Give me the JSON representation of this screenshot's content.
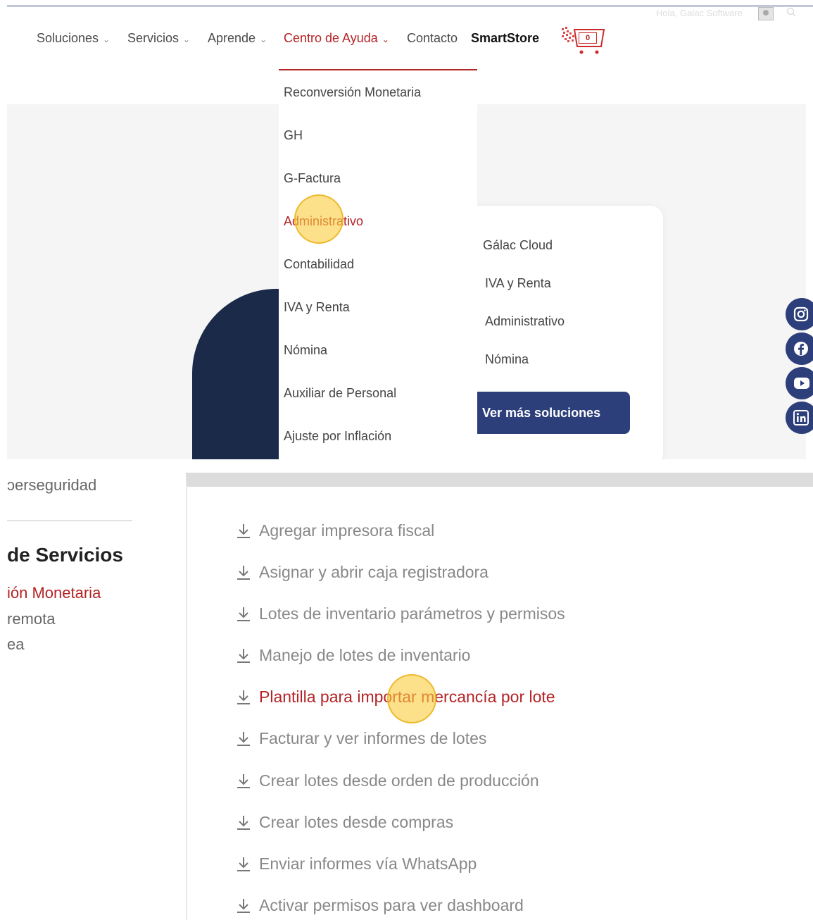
{
  "header": {
    "greeting": "Hola, Galac Software",
    "cart_count": "0"
  },
  "nav": {
    "items": [
      {
        "label": "Soluciones"
      },
      {
        "label": "Servicios"
      },
      {
        "label": "Aprende"
      },
      {
        "label": "Centro de Ayuda"
      },
      {
        "label": "Contacto"
      },
      {
        "label": "SmartStore"
      }
    ]
  },
  "dropdown": {
    "items": [
      "Reconversión Monetaria",
      "GH",
      "G-Factura",
      "Administrativo",
      "Contabilidad",
      "IVA y Renta",
      "Nómina",
      "Auxiliar de Personal",
      "Ajuste por Inflación"
    ]
  },
  "solutions": {
    "items": [
      "Gálac Cloud",
      "IVA y Renta",
      "Administrativo",
      "Nómina"
    ],
    "button": "Ver más soluciones"
  },
  "social": [
    "instagram-icon",
    "facebook-icon",
    "youtube-icon",
    "linkedin-icon"
  ],
  "sidebar": {
    "top_text": "ɔerseguridad",
    "heading": "de Servicios",
    "links": [
      "ión Monetaria",
      "remota",
      "ea"
    ]
  },
  "downloads": {
    "items": [
      "Agregar impresora fiscal",
      "Asignar y abrir caja registradora",
      "Lotes de inventario parámetros y permisos",
      "Manejo de lotes de inventario",
      "Plantilla para importar mercancía por lote",
      "Facturar y ver informes de lotes",
      "Crear lotes desde orden de producción",
      "Crear lotes desde compras",
      "Enviar informes vía WhatsApp",
      "Activar permisos para ver dashboard"
    ]
  },
  "colors": {
    "brand_red": "#b42326",
    "brand_navy": "#2d3f7a",
    "highlight": "#facc3c"
  }
}
